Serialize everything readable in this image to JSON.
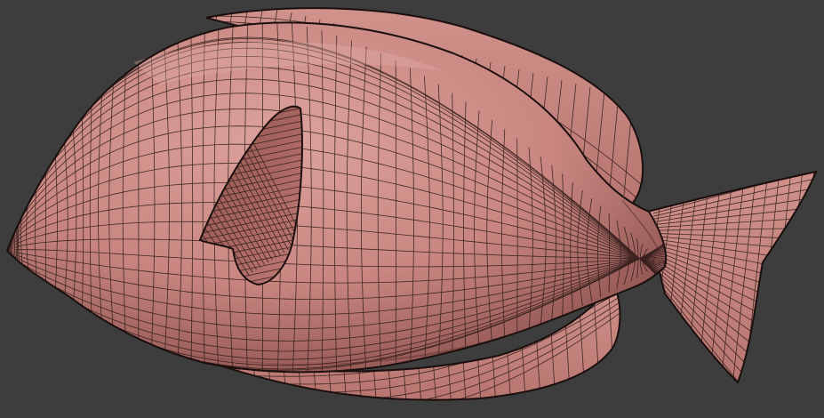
{
  "viewport": {
    "background": "#3d3d3d",
    "mode": "wireframe-on-shaded"
  },
  "model": {
    "subject": "fish",
    "surface_color": "#c98680",
    "surface_highlight": "#dca29c",
    "surface_shadow": "#8a4f4c",
    "wire_color": "#2a1816",
    "outline_color": "#1b0f0e"
  }
}
